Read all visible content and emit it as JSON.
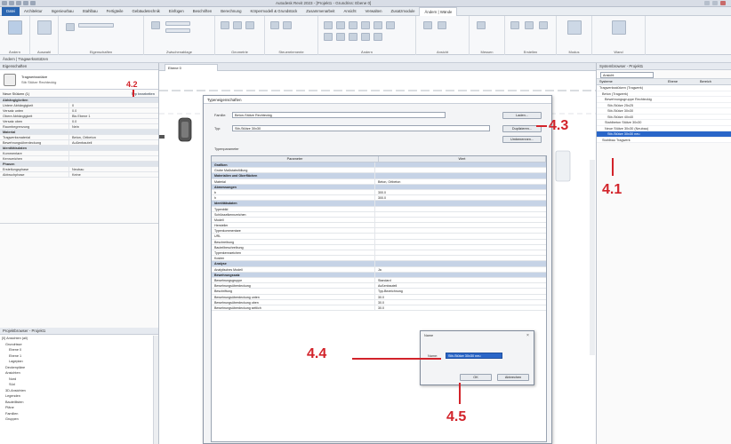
{
  "window": {
    "title": "Autodesk Revit 2023 - [Projekt1 - Grundriss: Ebene 0]"
  },
  "menu_tabs": [
    "Datei",
    "Architektur",
    "Ingenieurbau",
    "Stahlbau",
    "Fertigteile",
    "Gebäudetechnik",
    "Einfügen",
    "Beschriften",
    "Berechnung",
    "Körpermodell & Grundstück",
    "Zusammenarbeit",
    "Ansicht",
    "Verwalten",
    "Zusatzmodule",
    "Ändern | Wände"
  ],
  "ribbon_groups": [
    "Ändern",
    "Auswahl",
    "Eigenschaften",
    "Zwischenablage",
    "Geometrie",
    "Steuerelemente",
    "Ändern",
    "Ansicht",
    "Messen",
    "Erstellen",
    "Modus",
    "Wand"
  ],
  "options_bar": "Ändern | Tragwerksstützen",
  "properties": {
    "header": "Eigenschaften",
    "type_name": "Tragwerksstütze",
    "type_sub": "Stb Stütze Rechteckig",
    "selector": "Neue Stützen (1)",
    "edit_type": "Typ bearbeiten",
    "rows": [
      {
        "k": "Abhängigkeiten",
        "v": "",
        "sec": true
      },
      {
        "k": "Untere Abhängigkeit",
        "v": "0"
      },
      {
        "k": "Versatz unten",
        "v": "0.0"
      },
      {
        "k": "Obere Abhängigkeit",
        "v": "Bis Ebene 1"
      },
      {
        "k": "Versatz oben",
        "v": "0.0"
      },
      {
        "k": "Raumbegrenzung",
        "v": "Nein"
      },
      {
        "k": "Material",
        "v": "",
        "sec": true
      },
      {
        "k": "Tragwerksmaterial",
        "v": "Beton, Ortbeton"
      },
      {
        "k": "Bewehrungsüberdeckung",
        "v": "Außenbauteil"
      },
      {
        "k": "Identitätsdaten",
        "v": "",
        "sec": true
      },
      {
        "k": "Kommentare",
        "v": ""
      },
      {
        "k": "Kennzeichen",
        "v": ""
      },
      {
        "k": "Phasen",
        "v": "",
        "sec": true
      },
      {
        "k": "Erstellungsphase",
        "v": "Neubau"
      },
      {
        "k": "Abbruchphase",
        "v": "Keine"
      }
    ]
  },
  "project_browser": {
    "header": "Projektbrowser - Projekt1",
    "items": [
      "[0] Ansichten (all)",
      "Grundrisse",
      "Ebene 0",
      "Ebene 1",
      "Lageplan",
      "Deckenpläne",
      "Ansichten",
      "Nord",
      "Süd",
      "3D-Ansichten",
      "Legenden",
      "Bauteillisten",
      "Pläne",
      "Familien",
      "Gruppen"
    ]
  },
  "view": {
    "tab_label": "Ebene 0"
  },
  "type_dialog": {
    "title": "Typeneigenschaften",
    "family_label": "Familie:",
    "family_value": "Beton-Stütze Rechteckig",
    "type_label": "Typ:",
    "type_value": "Stb-Stütze 30x30",
    "load_button": "Laden...",
    "duplicate_button": "Duplizieren...",
    "rename_button": "Umbenennen...",
    "section_label": "Typenparameter",
    "col_param": "Parameter",
    "col_value": "Wert",
    "rows": [
      {
        "k": "Grafiken",
        "v": "",
        "sec": true
      },
      {
        "k": "Grobe Maßstabsfüllung",
        "v": ""
      },
      {
        "k": "Materialien und Oberflächen",
        "v": "",
        "sec": true
      },
      {
        "k": "Material",
        "v": "Beton, Ortbeton"
      },
      {
        "k": "Abmessungen",
        "v": "",
        "sec": true
      },
      {
        "k": "b",
        "v": "300.0"
      },
      {
        "k": "h",
        "v": "300.0"
      },
      {
        "k": "Identitätsdaten",
        "v": "",
        "sec": true
      },
      {
        "k": "Typenbild",
        "v": ""
      },
      {
        "k": "Schlüsselkennzeichen",
        "v": ""
      },
      {
        "k": "Modell",
        "v": ""
      },
      {
        "k": "Hersteller",
        "v": ""
      },
      {
        "k": "Typenkommentare",
        "v": ""
      },
      {
        "k": "URL",
        "v": ""
      },
      {
        "k": "Beschreibung",
        "v": ""
      },
      {
        "k": "Bauteilbeschreibung",
        "v": ""
      },
      {
        "k": "Typenkennzeichen",
        "v": ""
      },
      {
        "k": "Kosten",
        "v": ""
      },
      {
        "k": "Analyse",
        "v": "",
        "sec": true
      },
      {
        "k": "Analytisches Modell",
        "v": "Ja"
      },
      {
        "k": "Bewehrungssatz",
        "v": "",
        "sec": true
      },
      {
        "k": "Bewehrungsgruppe",
        "v": "Standard"
      },
      {
        "k": "Bewehrungsüberdeckung",
        "v": "Außenbauteil"
      },
      {
        "k": "Beschriftung",
        "v": "Typ-Bezeichnung"
      },
      {
        "k": "Bewehrungsüberdeckung unten",
        "v": "30.0"
      },
      {
        "k": "Bewehrungsüberdeckung oben",
        "v": "30.0"
      },
      {
        "k": "Bewehrungsüberdeckung seitlich",
        "v": "30.0"
      }
    ]
  },
  "name_dialog": {
    "title": "Name",
    "label": "Name:",
    "value": "Stb-Stütze 30x30 neu",
    "ok": "OK",
    "cancel": "Abbrechen"
  },
  "right_panel": {
    "header": "Systembrowser - Projekt1",
    "filter": "Ansicht",
    "columns": [
      "Systeme",
      "Ebene",
      "Bereich"
    ],
    "items": [
      "Tragwerksstützen (Tragwerk)",
      "Beton (Tragwerk)",
      "Bewehrungsgruppe Rechteckig",
      "Stb-Stütze 25x25",
      "Stb-Stütze 30x30",
      "Stb-Stütze 40x40",
      "Stahlbeton Stütze 30x30",
      "Neue Stütze 30x30 (Neubau)",
      "Stb-Stütze 30x30 neu",
      "Stahlbau Tragwerk"
    ]
  },
  "annotations": {
    "a41": "4.1",
    "a42": "4.2",
    "a43": "4.3",
    "a44": "4.4",
    "a45": "4.5"
  },
  "colors": {
    "annotation": "#d2232a",
    "file_tab": "#2b66b1",
    "selected": "#2a66c8"
  }
}
